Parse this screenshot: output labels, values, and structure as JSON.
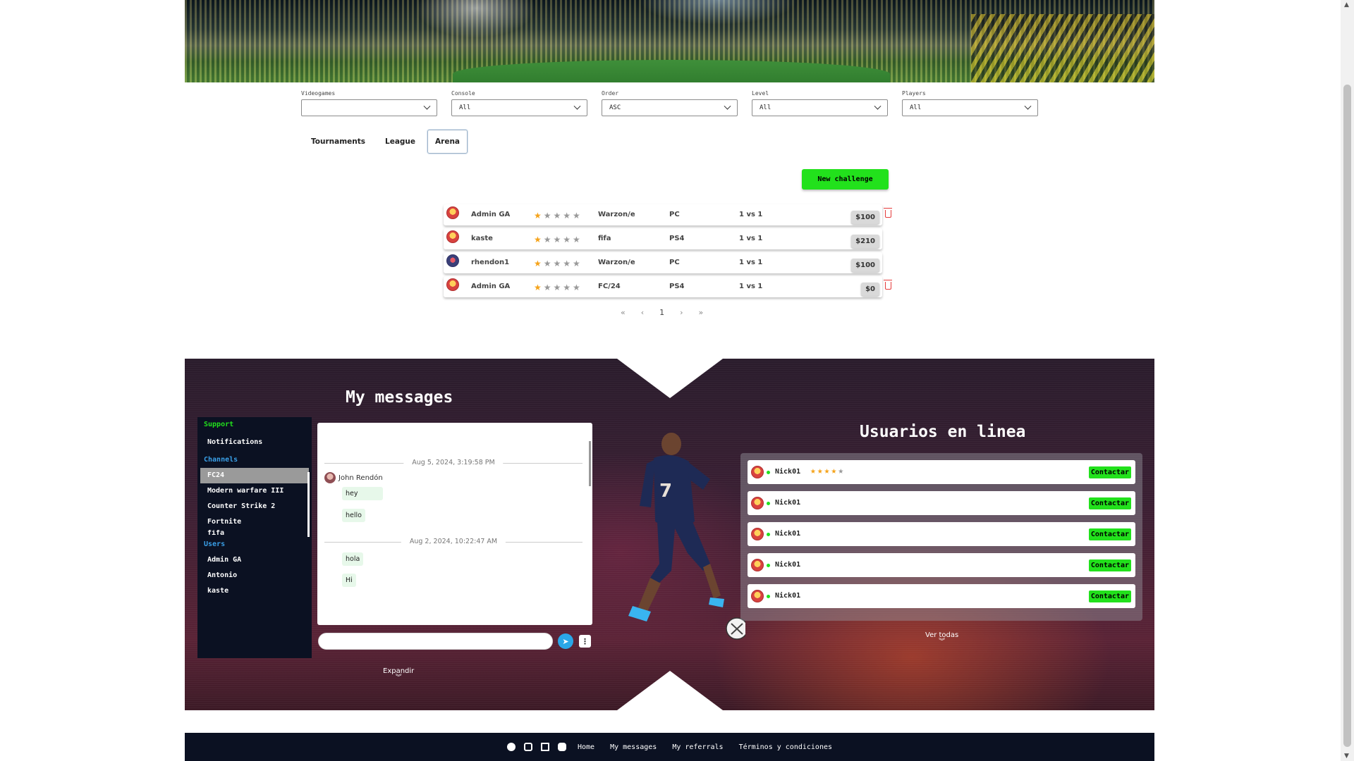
{
  "filters": [
    {
      "label": "Videogames",
      "value": ""
    },
    {
      "label": "Console",
      "value": "All"
    },
    {
      "label": "Order",
      "value": "ASC"
    },
    {
      "label": "Level",
      "value": "All"
    },
    {
      "label": "Players",
      "value": "All"
    }
  ],
  "tabs": [
    "Tournaments",
    "League",
    "Arena"
  ],
  "active_tab": "Arena",
  "new_challenge_label": "New challenge",
  "arena_rows": [
    {
      "user": "Admin GA",
      "stars": 1,
      "game": "Warzon/e",
      "console": "PC",
      "mode": "1 vs 1",
      "price": "$100",
      "deletable": true
    },
    {
      "user": "kaste",
      "stars": 1,
      "game": "fifa",
      "console": "PS4",
      "mode": "1 vs 1",
      "price": "$210",
      "deletable": false
    },
    {
      "user": "rhendon1",
      "stars": 1,
      "game": "Warzon/e",
      "console": "PC",
      "mode": "1 vs 1",
      "price": "$100",
      "deletable": false
    },
    {
      "user": "Admin GA",
      "stars": 1,
      "game": "FC/24",
      "console": "PS4",
      "mode": "1 vs 1",
      "price": "$0",
      "deletable": true
    }
  ],
  "pagination": {
    "first": "«",
    "prev": "‹",
    "current": "1",
    "next": "›",
    "last": "»"
  },
  "messages": {
    "title": "My messages",
    "support_heading": "Support",
    "notifications_label": "Notifications",
    "channels_heading": "Channels",
    "channels": [
      "FC24",
      "Modern warfare III",
      "Counter Strike 2",
      "Fortnite",
      "fifa"
    ],
    "selected_channel": "FC24",
    "users_heading": "Users",
    "users": [
      "Admin GA",
      "Antonio",
      "kaste"
    ],
    "date1": "Aug 5, 2024, 3:19:58 PM",
    "sender": "John Rendón",
    "bubbles1": [
      "hey",
      "hello"
    ],
    "date2": "Aug 2, 2024, 10:22:47 AM",
    "bubbles2": [
      "hola",
      "Hi"
    ],
    "input_value": "",
    "expand_label": "Expandir"
  },
  "online": {
    "title": "Usuarios en linea",
    "users": [
      {
        "name": "Nick01",
        "stars": 4,
        "show_stars": true
      },
      {
        "name": "Nick01",
        "stars": 0,
        "show_stars": false
      },
      {
        "name": "Nick01",
        "stars": 0,
        "show_stars": false
      },
      {
        "name": "Nick01",
        "stars": 0,
        "show_stars": false
      },
      {
        "name": "Nick01",
        "stars": 0,
        "show_stars": false
      }
    ],
    "contact_label": "Contactar",
    "see_all_label": "Ver todas"
  },
  "footer": {
    "icons": [
      "facebook-icon",
      "instagram-icon",
      "twitch-icon",
      "discord-icon"
    ],
    "links": [
      "Home",
      "My messages",
      "My referrals",
      "Términos y condiciones"
    ]
  },
  "colors": {
    "accent_green": "#22e11c",
    "dark_navy": "#0b1122",
    "link_blue": "#3aa0e8",
    "star_orange": "#f5a31a",
    "delete_red": "#e53b3b"
  }
}
